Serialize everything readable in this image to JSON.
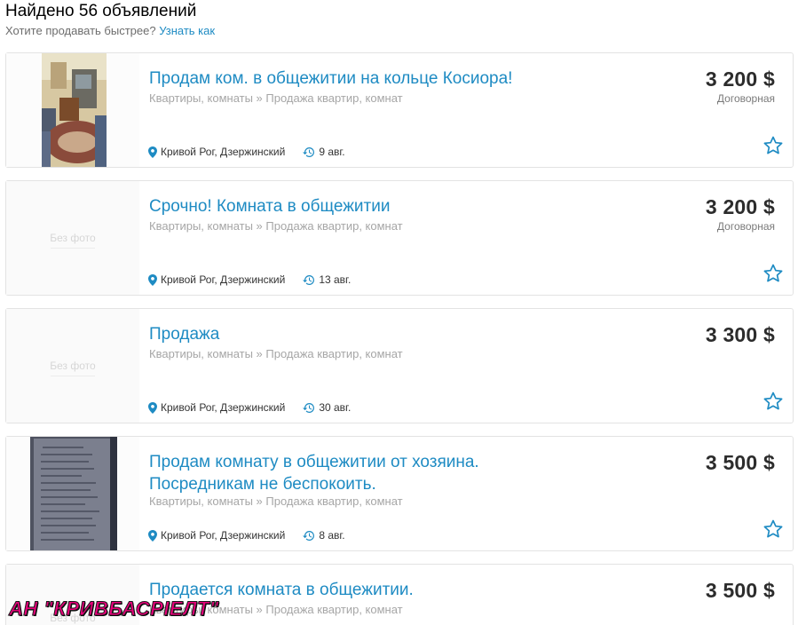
{
  "header": {
    "title": "Найдено 56 объявлений",
    "sub_text": "Хотите продавать быстрее?",
    "sub_link": "Узнать как"
  },
  "listings": [
    {
      "title": "Продам ком. в общежитии на кольце Косиора!",
      "category": "Квартиры, комнаты » Продажа квартир, комнат",
      "location": "Кривой Рог, Дзержинский",
      "date": "9 авг.",
      "price": "3 200 $",
      "price_note": "Договорная",
      "photo": true
    },
    {
      "title": "Срочно! Комната в общежитии",
      "category": "Квартиры, комнаты » Продажа квартир, комнат",
      "location": "Кривой Рог, Дзержинский",
      "date": "13 авг.",
      "price": "3 200 $",
      "price_note": "Договорная",
      "no_photo_label": "Без фото"
    },
    {
      "title": "Продажа",
      "category": "Квартиры, комнаты » Продажа квартир, комнат",
      "location": "Кривой Рог, Дзержинский",
      "date": "30 авг.",
      "price": "3 300 $",
      "no_photo_label": "Без фото"
    },
    {
      "title_line1": "Продам комнату в общежитии от хозяина.",
      "title_line2": "Посредникам не беспокоить.",
      "category": "Квартиры, комнаты » Продажа квартир, комнат",
      "location": "Кривой Рог, Дзержинский",
      "date": "8 авг.",
      "price": "3 500 $",
      "photo": true
    },
    {
      "title": "Продается комната в общежитии.",
      "category": "Квартиры, комнаты » Продажа квартир, комнат",
      "price": "3 500 $",
      "no_photo_label": "Без фото"
    }
  ],
  "watermark": "АН \"КРИВБАСРІЕЛТ\"",
  "colors": {
    "link": "#1e8bc3",
    "price": "#2c2c2c",
    "muted": "#a6a6a6",
    "watermark": "#e8007a"
  },
  "icons": {
    "location": "map-pin-icon",
    "date": "history-clock-icon",
    "favorite": "star-outline-icon"
  }
}
